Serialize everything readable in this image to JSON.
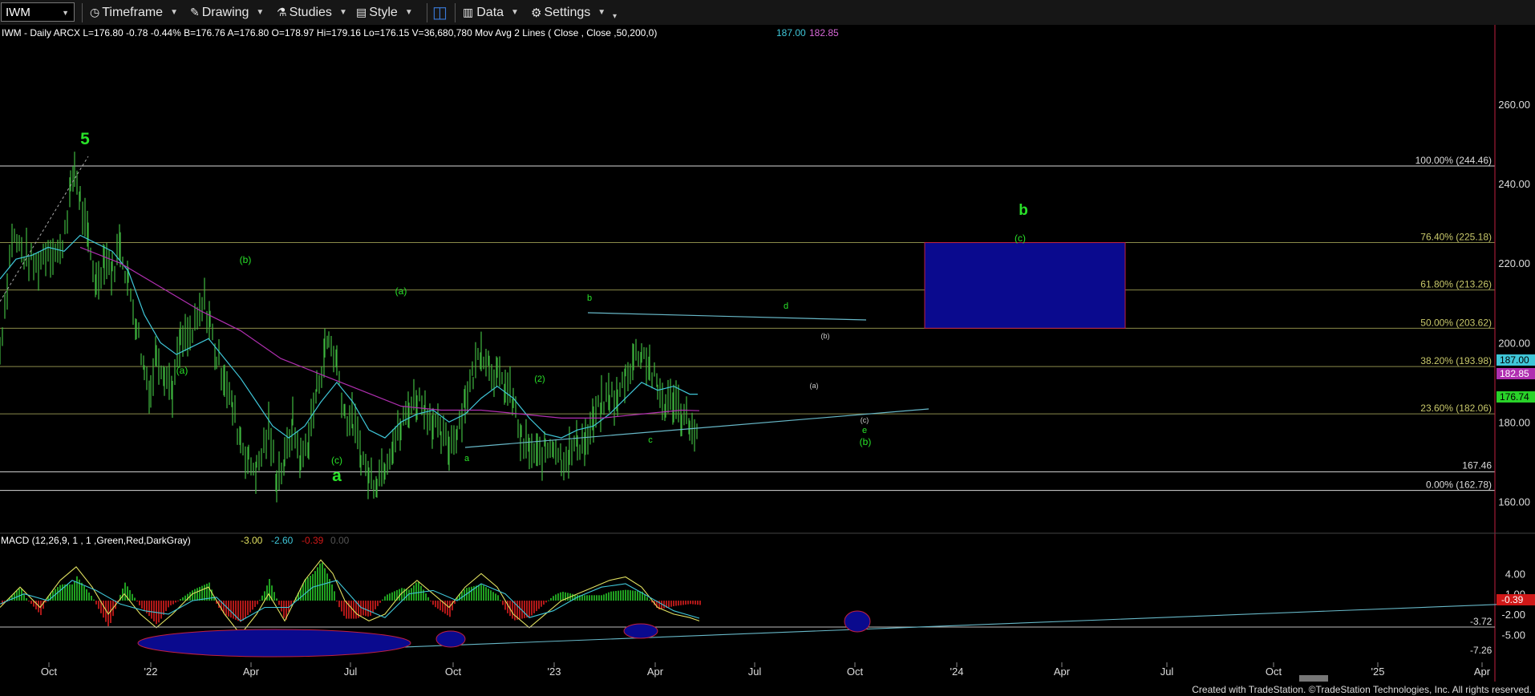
{
  "toolbar": {
    "symbol": "IWM",
    "items": [
      "Timeframe",
      "Drawing",
      "Studies",
      "Style",
      "Data",
      "Settings"
    ]
  },
  "legend": {
    "main": "IWM - Daily  ARCX  L=176.80  -0.78  -0.44%  B=176.76  A=176.80  O=178.97  Hi=179.16  Lo=176.15  V=36,680,780  Mov Avg 2 Lines ( Close , Close ,50,200,0)",
    "ma50": "187.00",
    "ma200": "182.85",
    "macd_label": "MACD (12,26,9, 1 , 1 ,Green,Red,DarkGray)",
    "macd_vals": [
      "-3.00",
      "-2.60",
      "-0.39",
      "0.00"
    ]
  },
  "footer": "Created with TradeStation. ©TradeStation Technologies, Inc. All rights reserved.",
  "colors": {
    "price": "#3fb83f",
    "ma50": "#3fc6d8",
    "ma200": "#b02fb0",
    "fib": "#8a8a4a",
    "box": "#0a0a8e",
    "wave": "#29e229",
    "macd": "#e0e060",
    "signal": "#3fc6d8",
    "hist_pos": "#20a020",
    "hist_neg": "#b01818"
  },
  "chart_data": [
    {
      "type": "line",
      "title": "IWM - Daily",
      "y_ticks": [
        160,
        180,
        200,
        220,
        240,
        260
      ],
      "x_ticks": [
        "Oct",
        "'22",
        "Apr",
        "Jul",
        "Oct",
        "'23",
        "Apr",
        "Jul",
        "Oct",
        "'24",
        "Apr",
        "Jul",
        "Oct",
        "'25",
        "Apr"
      ],
      "ylim": [
        152,
        280
      ],
      "price_tags": {
        "ma50": "187.00",
        "ma200": "182.85",
        "last": "176.74"
      },
      "fib_levels": [
        {
          "label": "100.00% (244.46)",
          "value": 244.46
        },
        {
          "label": "76.40% (225.18)",
          "value": 225.18
        },
        {
          "label": "61.80% (213.26)",
          "value": 213.26
        },
        {
          "label": "50.00% (203.62)",
          "value": 203.62
        },
        {
          "label": "38.20% (193.98)",
          "value": 193.98
        },
        {
          "label": "23.60% (182.06)",
          "value": 182.06
        },
        {
          "label": "0.00% (162.78)",
          "value": 162.78
        }
      ],
      "support": {
        "label": "167.46",
        "value": 167.46
      },
      "target_box": {
        "top": 225.18,
        "bottom": 203.62,
        "label": "(c)",
        "wave": "b"
      },
      "series": [
        {
          "values": [
            [
              0,
              198
            ],
            [
              15,
              227
            ],
            [
              30,
              222
            ],
            [
              45,
              219
            ],
            [
              60,
              224
            ],
            [
              75,
              222
            ],
            [
              88,
              238
            ],
            [
              93,
              244
            ],
            [
              100,
              236
            ],
            [
              110,
              225
            ],
            [
              120,
              215
            ],
            [
              130,
              222
            ],
            [
              140,
              218
            ],
            [
              150,
              225
            ],
            [
              160,
              215
            ],
            [
              170,
              205
            ],
            [
              180,
              193
            ],
            [
              188,
              188
            ],
            [
              195,
              198
            ],
            [
              205,
              193
            ],
            [
              215,
              188
            ],
            [
              225,
              200
            ],
            [
              240,
              202
            ],
            [
              255,
              210
            ],
            [
              262,
              205
            ],
            [
              270,
              196
            ],
            [
              280,
              192
            ],
            [
              290,
              183
            ],
            [
              300,
              176
            ],
            [
              310,
              170
            ],
            [
              320,
              168
            ],
            [
              335,
              178
            ],
            [
              345,
              166
            ],
            [
              355,
              170
            ],
            [
              365,
              180
            ],
            [
              375,
              170
            ],
            [
              385,
              176
            ],
            [
              395,
              188
            ],
            [
              405,
              198
            ],
            [
              410,
              201
            ],
            [
              420,
              195
            ],
            [
              430,
              182
            ],
            [
              440,
              180
            ],
            [
              450,
              172
            ],
            [
              460,
              166
            ],
            [
              470,
              166
            ],
            [
              480,
              170
            ],
            [
              490,
              175
            ],
            [
              500,
              178
            ],
            [
              510,
              184
            ],
            [
              520,
              186
            ],
            [
              530,
              184
            ],
            [
              540,
              180
            ],
            [
              550,
              176
            ],
            [
              560,
              174
            ],
            [
              570,
              178
            ],
            [
              580,
              186
            ],
            [
              590,
              192
            ],
            [
              600,
              199
            ],
            [
              610,
              195
            ],
            [
              620,
              191
            ],
            [
              630,
              189
            ],
            [
              640,
              185
            ],
            [
              650,
              175
            ],
            [
              660,
              173
            ],
            [
              670,
              171
            ],
            [
              680,
              173
            ],
            [
              690,
              175
            ],
            [
              700,
              171
            ],
            [
              710,
              172
            ],
            [
              720,
              175
            ],
            [
              730,
              175
            ],
            [
              740,
              180
            ],
            [
              750,
              184
            ],
            [
              760,
              187
            ],
            [
              770,
              185
            ],
            [
              780,
              192
            ],
            [
              790,
              196
            ],
            [
              800,
              198
            ],
            [
              810,
              194
            ],
            [
              820,
              188
            ],
            [
              830,
              184
            ],
            [
              840,
              186
            ],
            [
              850,
              182
            ],
            [
              860,
              180
            ],
            [
              866,
              175
            ],
            [
              872,
              178
            ]
          ]
        },
        {
          "values": [
            [
              0,
              216
            ],
            [
              20,
              221
            ],
            [
              40,
              222
            ],
            [
              60,
              224
            ],
            [
              80,
              223
            ],
            [
              100,
              227
            ],
            [
              120,
              225
            ],
            [
              140,
              223
            ],
            [
              160,
              218
            ],
            [
              180,
              207
            ],
            [
              200,
              200
            ],
            [
              220,
              197
            ],
            [
              240,
              199
            ],
            [
              260,
              201
            ],
            [
              280,
              196
            ],
            [
              300,
              191
            ],
            [
              320,
              185
            ],
            [
              340,
              179
            ],
            [
              360,
              176
            ],
            [
              380,
              179
            ],
            [
              400,
              185
            ],
            [
              420,
              190
            ],
            [
              440,
              185
            ],
            [
              460,
              178
            ],
            [
              480,
              176
            ],
            [
              500,
              180
            ],
            [
              520,
              182
            ],
            [
              540,
              183
            ],
            [
              560,
              180
            ],
            [
              580,
              182
            ],
            [
              600,
              186
            ],
            [
              620,
              189
            ],
            [
              640,
              186
            ],
            [
              660,
              181
            ],
            [
              680,
              177
            ],
            [
              700,
              176
            ],
            [
              720,
              178
            ],
            [
              740,
              179
            ],
            [
              760,
              182
            ],
            [
              780,
              186
            ],
            [
              800,
              190
            ],
            [
              820,
              188
            ],
            [
              840,
              189
            ],
            [
              860,
              187
            ],
            [
              870,
              187
            ]
          ]
        },
        {
          "values": [
            [
              100,
              224
            ],
            [
              150,
              220
            ],
            [
              200,
              214
            ],
            [
              250,
              208
            ],
            [
              300,
              203
            ],
            [
              350,
              196
            ],
            [
              400,
              192
            ],
            [
              450,
              188
            ],
            [
              500,
              184
            ],
            [
              550,
              183
            ],
            [
              600,
              183
            ],
            [
              650,
              182
            ],
            [
              700,
              181
            ],
            [
              750,
              181
            ],
            [
              800,
              182
            ],
            [
              850,
              183
            ],
            [
              872,
              182.85
            ]
          ]
        }
      ]
    },
    {
      "type": "line",
      "title": "MACD (12,26,9, 1 , 1 ,Green,Red,DarkGray)",
      "y_ticks": [
        4.0,
        1.0,
        -2.0,
        -5.0
      ],
      "ylim": [
        -9,
        7
      ],
      "value_tags": [
        "-0.39",
        "-3.72",
        "-7.26"
      ],
      "series": [
        {
          "values": [
            [
              0,
              -1
            ],
            [
              25,
              2
            ],
            [
              50,
              -1
            ],
            [
              75,
              3
            ],
            [
              95,
              5
            ],
            [
              115,
              2
            ],
            [
              135,
              -2
            ],
            [
              155,
              1
            ],
            [
              175,
              -2
            ],
            [
              195,
              -4
            ],
            [
              215,
              -2
            ],
            [
              240,
              1
            ],
            [
              260,
              2
            ],
            [
              280,
              -2
            ],
            [
              300,
              -5
            ],
            [
              320,
              -2
            ],
            [
              335,
              1
            ],
            [
              355,
              -3
            ],
            [
              380,
              3
            ],
            [
              400,
              6
            ],
            [
              415,
              4
            ],
            [
              430,
              0
            ],
            [
              445,
              -2
            ],
            [
              460,
              -3
            ],
            [
              480,
              -2
            ],
            [
              500,
              1
            ],
            [
              520,
              3
            ],
            [
              540,
              1
            ],
            [
              560,
              -1
            ],
            [
              580,
              2
            ],
            [
              600,
              4
            ],
            [
              620,
              2
            ],
            [
              640,
              -2
            ],
            [
              660,
              -4
            ],
            [
              680,
              -2
            ],
            [
              700,
              0
            ],
            [
              720,
              1
            ],
            [
              740,
              2
            ],
            [
              760,
              3
            ],
            [
              780,
              3.5
            ],
            [
              800,
              2
            ],
            [
              820,
              -1
            ],
            [
              840,
              -2
            ],
            [
              860,
              -2.5
            ],
            [
              872,
              -3
            ]
          ]
        },
        {
          "values": [
            [
              0,
              -0.5
            ],
            [
              30,
              1
            ],
            [
              60,
              0
            ],
            [
              90,
              3
            ],
            [
              120,
              1.5
            ],
            [
              150,
              -0.5
            ],
            [
              180,
              -1.5
            ],
            [
              210,
              -2
            ],
            [
              240,
              0
            ],
            [
              270,
              0.5
            ],
            [
              300,
              -3
            ],
            [
              330,
              -1
            ],
            [
              360,
              -1
            ],
            [
              390,
              2
            ],
            [
              420,
              3
            ],
            [
              450,
              -1
            ],
            [
              480,
              -2.5
            ],
            [
              510,
              1
            ],
            [
              540,
              1.5
            ],
            [
              570,
              0
            ],
            [
              600,
              2.5
            ],
            [
              630,
              1
            ],
            [
              660,
              -2.5
            ],
            [
              690,
              -1.5
            ],
            [
              720,
              0.5
            ],
            [
              750,
              2
            ],
            [
              780,
              2.5
            ],
            [
              810,
              0.5
            ],
            [
              840,
              -1.5
            ],
            [
              872,
              -2.6
            ]
          ]
        }
      ],
      "histogram_sign": [
        "+",
        "+",
        "-",
        "+",
        "+",
        "-",
        "+",
        "-",
        "-",
        "+",
        "+",
        "-",
        "-",
        "+",
        "-",
        "+",
        "+",
        "-",
        "-",
        "+",
        "+",
        "-",
        "+",
        "+",
        "-",
        "-",
        "+",
        "+",
        "+",
        "-",
        "-"
      ]
    }
  ]
}
